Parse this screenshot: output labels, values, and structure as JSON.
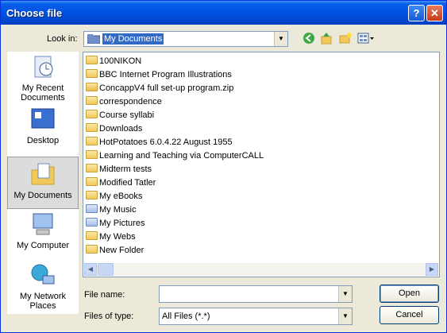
{
  "window": {
    "title": "Choose file",
    "help_label": "?",
    "close_label": "✕"
  },
  "lookin": {
    "label": "Look in:",
    "value": "My Documents"
  },
  "toolbar": {
    "back_icon": "back-icon",
    "up_icon": "up-folder-icon",
    "newfolder_icon": "new-folder-icon",
    "views_icon": "views-menu-icon"
  },
  "places": [
    {
      "label": "My Recent Documents"
    },
    {
      "label": "Desktop"
    },
    {
      "label": "My Documents"
    },
    {
      "label": "My Computer"
    },
    {
      "label": "My Network Places"
    }
  ],
  "files": [
    {
      "name": "100NIKON"
    },
    {
      "name": "BBC Internet Program Illustrations"
    },
    {
      "name": "ConcappV4 full set-up program.zip"
    },
    {
      "name": "correspondence"
    },
    {
      "name": "Course syllabi"
    },
    {
      "name": "Downloads"
    },
    {
      "name": "HotPotatoes 6.0.4.22 August 1955"
    },
    {
      "name": "Learning and Teaching via ComputerCALL"
    },
    {
      "name": "Midterm tests"
    },
    {
      "name": "Modified Tatler"
    },
    {
      "name": "My eBooks"
    },
    {
      "name": "My Music"
    },
    {
      "name": "My Pictures"
    },
    {
      "name": "My Webs"
    },
    {
      "name": "New Folder"
    }
  ],
  "form": {
    "filename_label": "File name:",
    "filename_value": "",
    "filetype_label": "Files of type:",
    "filetype_value": "All Files (*.*)"
  },
  "buttons": {
    "open": "Open",
    "cancel": "Cancel"
  }
}
